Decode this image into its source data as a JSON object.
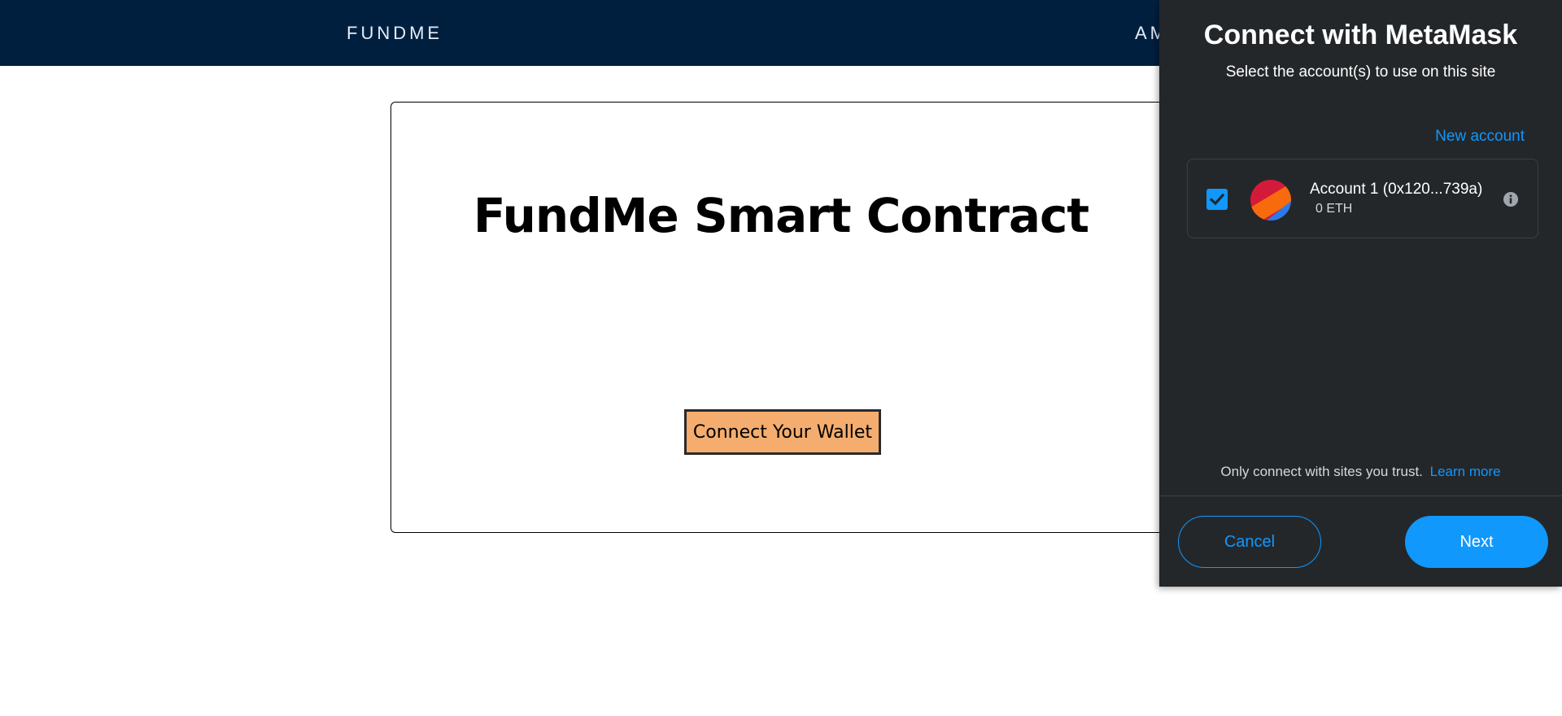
{
  "navbar": {
    "brand": "FUNDME",
    "partial_link": "AM"
  },
  "card": {
    "title": "FundMe Smart Contract",
    "connect_button": "Connect Your Wallet"
  },
  "metamask": {
    "title": "Connect with MetaMask",
    "subtitle": "Select the account(s) to use on this site",
    "new_account": "New account",
    "account": {
      "name": "Account 1 (0x120...739a)",
      "balance": "0 ETH",
      "checked": true
    },
    "trust_text": "Only connect with sites you trust.",
    "learn_more": "Learn more",
    "cancel": "Cancel",
    "next": "Next",
    "accent_color": "#1098fc",
    "panel_color": "#24272a"
  },
  "icons": [
    "checkbox-check-icon",
    "account-avatar-icon",
    "info-icon"
  ]
}
